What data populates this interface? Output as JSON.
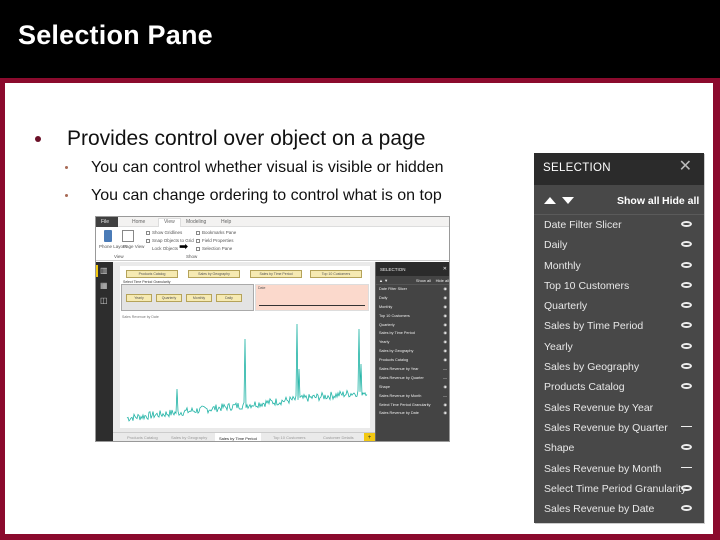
{
  "slide": {
    "title": "Selection Pane",
    "bullets": [
      {
        "text": "Provides control over object on a page",
        "level": 1
      },
      {
        "text": "You can control whether visual is visible or hidden",
        "level": 2
      },
      {
        "text": "You can change ordering to control what is on top",
        "level": 2
      }
    ],
    "colors": {
      "frame": "#8b0a2d",
      "title_bar": "#000000",
      "pane_bg": "#484848",
      "pane_header": "#2b2b2b"
    }
  },
  "embedded_app": {
    "ribbon_tabs": [
      "File",
      "Home",
      "View",
      "Modeling",
      "Help"
    ],
    "active_ribbon_tab": "View",
    "ribbon_items": {
      "phone_layout": "Phone Layout",
      "page_view": "Page View",
      "view_group": "View",
      "show_gridlines": "Show Gridlines",
      "snap_objects": "Snap Objects to Grid",
      "lock_objects": "Lock Objects",
      "bookmarks_pane": "Bookmarks Pane",
      "field_properties": "Field Properties",
      "selection_pane": "Selection Pane",
      "show_group": "Show"
    },
    "top_buttons": [
      "Products Catalog",
      "Sales by Geography",
      "Sales by Time Period",
      "Top 10 Customers"
    ],
    "slicer_label": "Select Time Period Granularity",
    "slicer_buttons": [
      "Yearly",
      "Quarterly",
      "Monthly",
      "Daily"
    ],
    "filter_label": "Date",
    "chart_title": "Sales Revenue by Date",
    "page_tabs": [
      "Products Catalog",
      "Sales by Geography",
      "Sales by Time Period",
      "Top 10 Customers",
      "Customer Details"
    ],
    "active_page_tab": "Sales by Time Period",
    "add_page": "+"
  },
  "selection_pane": {
    "title": "SELECTION",
    "close_label": "✕",
    "show_all": "Show all",
    "hide_all": "Hide all",
    "items": [
      {
        "label": "Date Filter Slicer",
        "visible": true
      },
      {
        "label": "Daily",
        "visible": true
      },
      {
        "label": "Monthly",
        "visible": true
      },
      {
        "label": "Top 10 Customers",
        "visible": true
      },
      {
        "label": "Quarterly",
        "visible": true
      },
      {
        "label": "Sales by Time Period",
        "visible": true
      },
      {
        "label": "Yearly",
        "visible": true
      },
      {
        "label": "Sales by Geography",
        "visible": true
      },
      {
        "label": "Products Catalog",
        "visible": true
      },
      {
        "label": "Sales Revenue by Year",
        "visible": null
      },
      {
        "label": "Sales Revenue by Quarter",
        "visible": false
      },
      {
        "label": "Shape",
        "visible": true
      },
      {
        "label": "Sales Revenue by Month",
        "visible": false
      },
      {
        "label": "Select Time Period Granularity",
        "visible": true
      },
      {
        "label": "Sales Revenue by Date",
        "visible": true
      }
    ]
  },
  "mini_selection_pane": {
    "title": "SELECTION",
    "show_all": "Show all",
    "hide_all": "Hide all"
  }
}
